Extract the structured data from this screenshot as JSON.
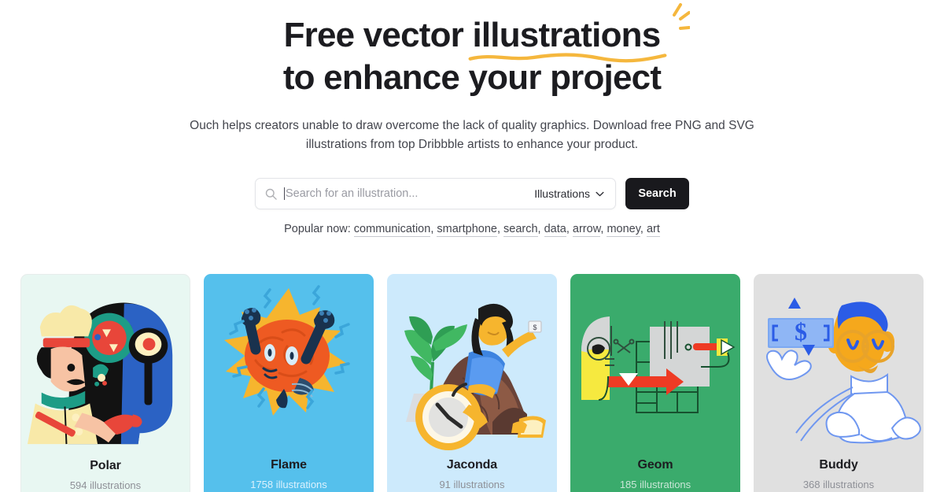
{
  "hero": {
    "headline_line1_prefix": "Free vector ",
    "headline_accent": "illustrations",
    "headline_line2": "to enhance your project",
    "subhead": "Ouch helps creators unable to draw overcome the lack of quality graphics. Download free PNG and SVG illustrations from top Dribbble artists to enhance your product.",
    "accent_color": "#f5b73d",
    "text_color": "#1c1c20"
  },
  "search": {
    "placeholder": "Search for an illustration...",
    "value": "",
    "type_label": "Illustrations",
    "button_label": "Search",
    "search_icon": "search-icon",
    "chevron_icon": "chevron-down-icon",
    "button_bg": "#19191d"
  },
  "popular": {
    "label": "Popular now:",
    "tags": [
      "communication",
      "smartphone",
      "search",
      "data",
      "arrow",
      "money",
      "art"
    ],
    "separator": ", "
  },
  "cards": [
    {
      "name": "Polar",
      "count": "594 illustrations",
      "bg": "#e8f7f2",
      "outlined": true,
      "style": "light",
      "art": "chef-with-frying-pan-illustration"
    },
    {
      "name": "Flame",
      "count": "1758 illustrations",
      "bg": "#55c0ec",
      "outlined": false,
      "style": "blue",
      "art": "energized-brain-character-illustration"
    },
    {
      "name": "Jaconda",
      "count": "91 illustrations",
      "bg": "#cdeafc",
      "outlined": false,
      "style": "light",
      "art": "woman-on-rock-with-clock-illustration"
    },
    {
      "name": "Geom",
      "count": "185 illustrations",
      "bg": "#3aab6c",
      "outlined": false,
      "style": "dark",
      "art": "abstract-geometric-shapes-illustration"
    },
    {
      "name": "Buddy",
      "count": "368 illustrations",
      "bg": "#e0e0e0",
      "outlined": false,
      "style": "light",
      "art": "man-holding-dollar-bill-illustration"
    }
  ]
}
